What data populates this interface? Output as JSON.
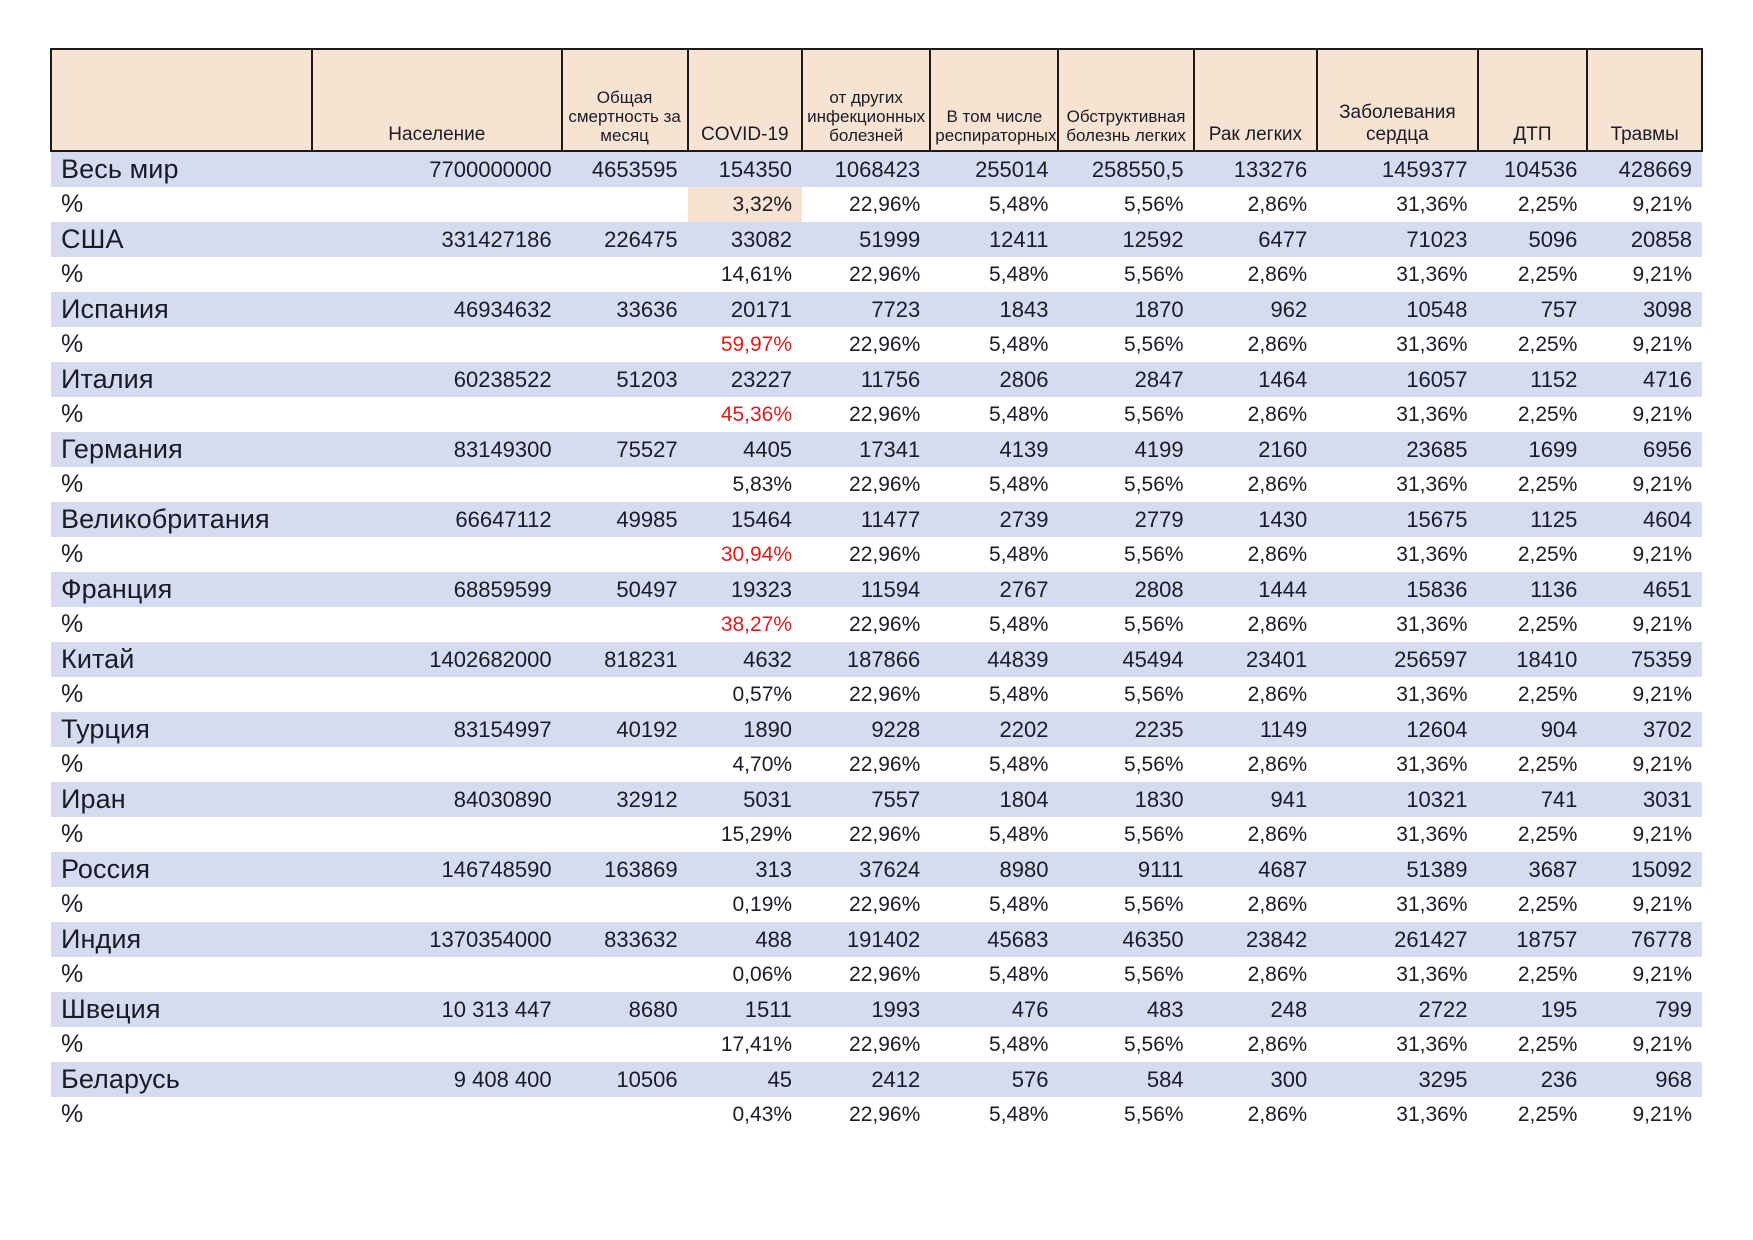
{
  "table": {
    "columns": [
      {
        "id": "name",
        "label": ""
      },
      {
        "id": "pop",
        "label": "Население"
      },
      {
        "id": "death",
        "label": "Общая смертность за месяц"
      },
      {
        "id": "covid",
        "label": "COVID-19"
      },
      {
        "id": "inf",
        "label": "от других инфекционных болезней"
      },
      {
        "id": "resp",
        "label": "В том числе респираторных"
      },
      {
        "id": "obstr",
        "label": "Обструктивная болезнь легких"
      },
      {
        "id": "lung",
        "label": "Рак легких"
      },
      {
        "id": "heart",
        "label": "Заболевания сердца"
      },
      {
        "id": "dtp",
        "label": "ДТП"
      },
      {
        "id": "traum",
        "label": "Травмы"
      }
    ],
    "percent_row_label": "%",
    "rows": [
      {
        "name": "Весь мир",
        "values": [
          "7700000000",
          "4653595",
          "154350",
          "1068423",
          "255014",
          "258550,5",
          "133276",
          "1459377",
          "104536",
          "428669"
        ],
        "percents": [
          "",
          "",
          "3,32%",
          "22,96%",
          "5,48%",
          "5,56%",
          "2,86%",
          "31,36%",
          "2,25%",
          "9,21%"
        ],
        "covid_highlight": true,
        "covid_red": false
      },
      {
        "name": "США",
        "values": [
          "331427186",
          "226475",
          "33082",
          "51999",
          "12411",
          "12592",
          "6477",
          "71023",
          "5096",
          "20858"
        ],
        "percents": [
          "",
          "",
          "14,61%",
          "22,96%",
          "5,48%",
          "5,56%",
          "2,86%",
          "31,36%",
          "2,25%",
          "9,21%"
        ],
        "covid_highlight": false,
        "covid_red": false
      },
      {
        "name": "Испания",
        "values": [
          "46934632",
          "33636",
          "20171",
          "7723",
          "1843",
          "1870",
          "962",
          "10548",
          "757",
          "3098"
        ],
        "percents": [
          "",
          "",
          "59,97%",
          "22,96%",
          "5,48%",
          "5,56%",
          "2,86%",
          "31,36%",
          "2,25%",
          "9,21%"
        ],
        "covid_highlight": false,
        "covid_red": true
      },
      {
        "name": "Италия",
        "values": [
          "60238522",
          "51203",
          "23227",
          "11756",
          "2806",
          "2847",
          "1464",
          "16057",
          "1152",
          "4716"
        ],
        "percents": [
          "",
          "",
          "45,36%",
          "22,96%",
          "5,48%",
          "5,56%",
          "2,86%",
          "31,36%",
          "2,25%",
          "9,21%"
        ],
        "covid_highlight": false,
        "covid_red": true
      },
      {
        "name": "Германия",
        "values": [
          "83149300",
          "75527",
          "4405",
          "17341",
          "4139",
          "4199",
          "2160",
          "23685",
          "1699",
          "6956"
        ],
        "percents": [
          "",
          "",
          "5,83%",
          "22,96%",
          "5,48%",
          "5,56%",
          "2,86%",
          "31,36%",
          "2,25%",
          "9,21%"
        ],
        "covid_highlight": false,
        "covid_red": false
      },
      {
        "name": "Великобритания",
        "values": [
          "66647112",
          "49985",
          "15464",
          "11477",
          "2739",
          "2779",
          "1430",
          "15675",
          "1125",
          "4604"
        ],
        "percents": [
          "",
          "",
          "30,94%",
          "22,96%",
          "5,48%",
          "5,56%",
          "2,86%",
          "31,36%",
          "2,25%",
          "9,21%"
        ],
        "covid_highlight": false,
        "covid_red": true
      },
      {
        "name": "Франция",
        "values": [
          "68859599",
          "50497",
          "19323",
          "11594",
          "2767",
          "2808",
          "1444",
          "15836",
          "1136",
          "4651"
        ],
        "percents": [
          "",
          "",
          "38,27%",
          "22,96%",
          "5,48%",
          "5,56%",
          "2,86%",
          "31,36%",
          "2,25%",
          "9,21%"
        ],
        "covid_highlight": false,
        "covid_red": true
      },
      {
        "name": "Китай",
        "values": [
          "1402682000",
          "818231",
          "4632",
          "187866",
          "44839",
          "45494",
          "23401",
          "256597",
          "18410",
          "75359"
        ],
        "percents": [
          "",
          "",
          "0,57%",
          "22,96%",
          "5,48%",
          "5,56%",
          "2,86%",
          "31,36%",
          "2,25%",
          "9,21%"
        ],
        "covid_highlight": false,
        "covid_red": false
      },
      {
        "name": "Турция",
        "values": [
          "83154997",
          "40192",
          "1890",
          "9228",
          "2202",
          "2235",
          "1149",
          "12604",
          "904",
          "3702"
        ],
        "percents": [
          "",
          "",
          "4,70%",
          "22,96%",
          "5,48%",
          "5,56%",
          "2,86%",
          "31,36%",
          "2,25%",
          "9,21%"
        ],
        "covid_highlight": false,
        "covid_red": false
      },
      {
        "name": "Иран",
        "values": [
          "84030890",
          "32912",
          "5031",
          "7557",
          "1804",
          "1830",
          "941",
          "10321",
          "741",
          "3031"
        ],
        "percents": [
          "",
          "",
          "15,29%",
          "22,96%",
          "5,48%",
          "5,56%",
          "2,86%",
          "31,36%",
          "2,25%",
          "9,21%"
        ],
        "covid_highlight": false,
        "covid_red": false
      },
      {
        "name": "Россия",
        "values": [
          "146748590",
          "163869",
          "313",
          "37624",
          "8980",
          "9111",
          "4687",
          "51389",
          "3687",
          "15092"
        ],
        "percents": [
          "",
          "",
          "0,19%",
          "22,96%",
          "5,48%",
          "5,56%",
          "2,86%",
          "31,36%",
          "2,25%",
          "9,21%"
        ],
        "covid_highlight": false,
        "covid_red": false
      },
      {
        "name": "Индия",
        "values": [
          "1370354000",
          "833632",
          "488",
          "191402",
          "45683",
          "46350",
          "23842",
          "261427",
          "18757",
          "76778"
        ],
        "percents": [
          "",
          "",
          "0,06%",
          "22,96%",
          "5,48%",
          "5,56%",
          "2,86%",
          "31,36%",
          "2,25%",
          "9,21%"
        ],
        "covid_highlight": false,
        "covid_red": false
      },
      {
        "name": "Швеция",
        "values": [
          "10 313 447",
          "8680",
          "1511",
          "1993",
          "476",
          "483",
          "248",
          "2722",
          "195",
          "799"
        ],
        "percents": [
          "",
          "",
          "17,41%",
          "22,96%",
          "5,48%",
          "5,56%",
          "2,86%",
          "31,36%",
          "2,25%",
          "9,21%"
        ],
        "covid_highlight": false,
        "covid_red": false
      },
      {
        "name": "Беларусь",
        "values": [
          "9 408 400",
          "10506",
          "45",
          "2412",
          "576",
          "584",
          "300",
          "3295",
          "236",
          "968"
        ],
        "percents": [
          "",
          "",
          "0,43%",
          "22,96%",
          "5,48%",
          "5,56%",
          "2,86%",
          "31,36%",
          "2,25%",
          "9,21%"
        ],
        "covid_highlight": false,
        "covid_red": false
      }
    ]
  },
  "colors": {
    "header_bg": "#f7e3d2",
    "data_row_bg": "#d6dcf0",
    "pct_row_bg": "#ffffff",
    "red_text": "#e01b1b",
    "grid_line": "#1a1a1a"
  }
}
